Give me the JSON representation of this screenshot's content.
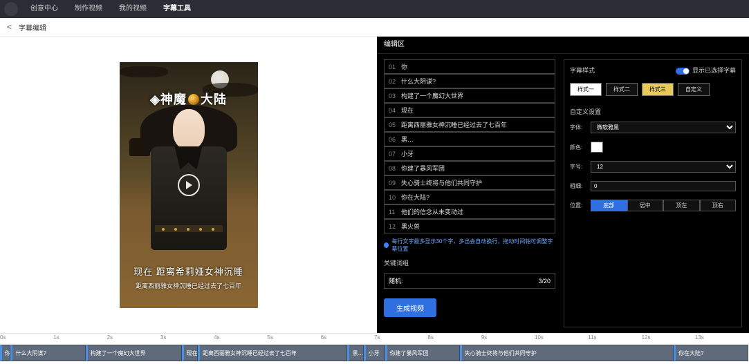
{
  "nav": {
    "tabs": [
      "创意中心",
      "制作视频",
      "我的视频",
      "字幕工具"
    ],
    "active": 3
  },
  "breadcrumb": {
    "back": "<",
    "title": "字幕编辑"
  },
  "preview": {
    "title_a": "神魔",
    "title_b": "大陆",
    "subtitle_main": "现在 距离希莉娅女神沉睡",
    "subtitle_sub": "距离西丽雅女神沉睡已经过去了七百年"
  },
  "rightPanel": {
    "header": "编辑区",
    "lines": [
      {
        "n": "01",
        "t": "你"
      },
      {
        "n": "02",
        "t": "什么大阴谋?"
      },
      {
        "n": "03",
        "t": "构建了一个魔幻大世界"
      },
      {
        "n": "04",
        "t": "现在"
      },
      {
        "n": "05",
        "t": "距离西丽雅女神沉睡已经过去了七百年"
      },
      {
        "n": "06",
        "t": "黑… "
      },
      {
        "n": "07",
        "t": "小牙"
      },
      {
        "n": "08",
        "t": "你建了暴风军团"
      },
      {
        "n": "09",
        "t": "失心骑士终将与他们共同守护"
      },
      {
        "n": "10",
        "t": "你在大陆?"
      },
      {
        "n": "11",
        "t": "他们的信念从未变动过"
      },
      {
        "n": "12",
        "t": "黑火兽"
      }
    ],
    "tip": "每行文字最多显示30个字，多出会自动换行，拖动时间轴可调整字幕位置",
    "keywordLabel": "关键词组",
    "keyword": {
      "label": "随机:",
      "count": "3/20"
    },
    "generate": "生成视频",
    "styleHeader": "字幕样式",
    "toggleLabel": "显示已选择字幕",
    "styleButtons": [
      "样式一",
      "样式二",
      "样式三",
      "自定义"
    ],
    "customHeader": "自定义设置",
    "font": {
      "label": "字体:",
      "value": "微软雅黑"
    },
    "color": {
      "label": "颜色:"
    },
    "size": {
      "label": "字号:",
      "value": "12"
    },
    "stroke": {
      "label": "粗细:",
      "value": "0"
    },
    "pos": {
      "label": "位置:",
      "options": [
        "底部",
        "居中",
        "顶左",
        "顶右"
      ],
      "active": 0
    }
  },
  "timeline": {
    "ticks": [
      "0s",
      "1s",
      "2s",
      "3s",
      "4s",
      "5s",
      "6s",
      "7s",
      "8s",
      "9s",
      "10s",
      "11s",
      "12s",
      "13s"
    ],
    "clips": [
      {
        "start": 0.0,
        "end": 0.2,
        "t": "你"
      },
      {
        "start": 0.2,
        "end": 1.6,
        "t": "什么大阴谋?"
      },
      {
        "start": 1.6,
        "end": 3.4,
        "t": "构建了一个魔幻大世界"
      },
      {
        "start": 3.4,
        "end": 3.7,
        "t": "现在"
      },
      {
        "start": 3.7,
        "end": 6.5,
        "t": "距离西丽雅女神沉睡已经过去了七百年"
      },
      {
        "start": 6.5,
        "end": 6.8,
        "t": "黑…"
      },
      {
        "start": 6.8,
        "end": 7.2,
        "t": "小牙"
      },
      {
        "start": 7.2,
        "end": 8.6,
        "t": "你建了暴风军团"
      },
      {
        "start": 8.6,
        "end": 12.6,
        "t": "失心骑士终将与他们共同守护"
      },
      {
        "start": 12.6,
        "end": 14.0,
        "t": "你在大陆?"
      }
    ],
    "pxPerSec": 77.3
  }
}
